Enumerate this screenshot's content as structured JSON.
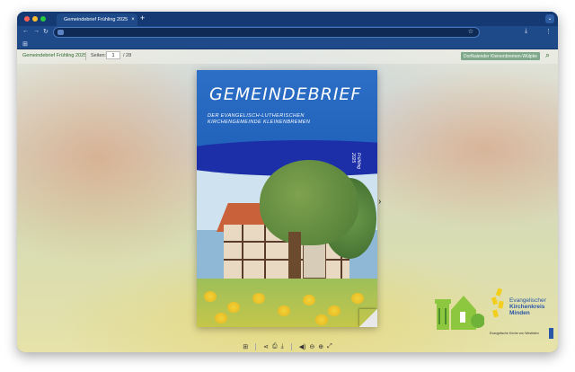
{
  "colors": {
    "close": "#ff5f57",
    "minimize": "#febc2e",
    "maximize": "#28c840",
    "accent": "#1f4a8a",
    "ext_button": "#7fa98a"
  },
  "browser": {
    "tab_title": "Gemeindebrief Frühling 2025",
    "tab_close": "×",
    "new_tab": "+",
    "tab_menu": "⌄",
    "back": "←",
    "forward": "→",
    "reload": "↻",
    "star": "☆",
    "download": "⤓",
    "menu": "⋮",
    "apps": "⊞"
  },
  "viewer": {
    "doc_title": "Gemeindebrief Frühling 2025",
    "page_label": "Seiten:",
    "page_current": "1",
    "page_total": "/ 28",
    "ext_button": "Dorfkalender Kleinenbremen-Wülpke",
    "search": "⌕",
    "next": "›"
  },
  "cover": {
    "title": "GEMEINDEBRIEF",
    "subtitle_line1": "DER EVANGELISCH-LUTHERISCHEN",
    "subtitle_line2": "KIRCHENGEMEINDE KLEINENBREMEN",
    "season": "Frühling",
    "year": "2025"
  },
  "logos": {
    "kk_line1": "Evangelischer",
    "kk_line2": "Kirchenkreis",
    "kk_line3": "Minden",
    "kk_small": "Evangelische Kirche von Westfalen"
  },
  "bottom_toolbar": {
    "grid": "⊞",
    "share": "⋖",
    "print": "⎙",
    "download": "⤓",
    "sound": "◀)",
    "zoom_out": "⊖",
    "zoom_in": "⊕",
    "fullscreen": "⤢"
  }
}
